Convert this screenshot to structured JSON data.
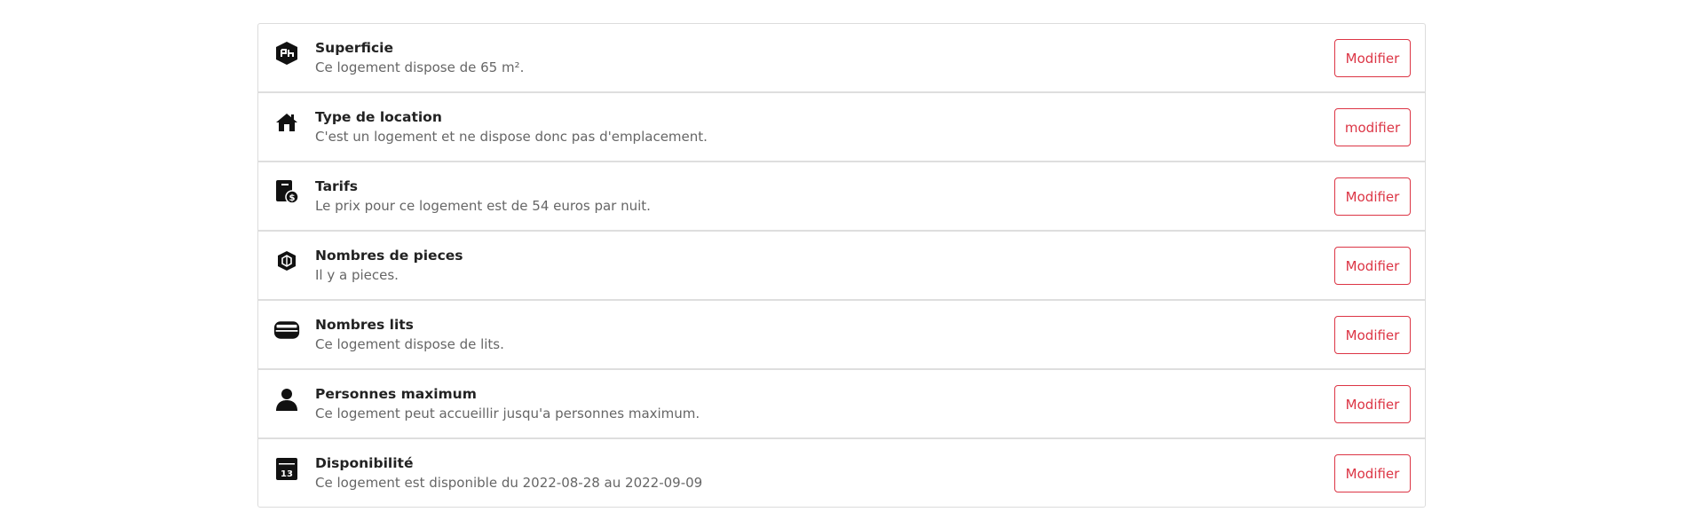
{
  "items": [
    {
      "icon": "floor-plan-icon",
      "title": "Superficie",
      "description": "Ce logement dispose de 65 m².",
      "button": "Modifier"
    },
    {
      "icon": "house-icon",
      "title": "Type de location",
      "description": "C'est un logement et ne dispose donc pas d'emplacement.",
      "button": "modifier"
    },
    {
      "icon": "price-tag-icon",
      "title": "Tarifs",
      "description": "Le prix pour ce logement est de 54 euros par nuit.",
      "button": "Modifier"
    },
    {
      "icon": "rooms-cube-icon",
      "title": "Nombres de pieces",
      "description": "Il y a pieces.",
      "button": "Modifier"
    },
    {
      "icon": "bed-icon",
      "title": "Nombres lits",
      "description": "Ce logement dispose de lits.",
      "button": "Modifier"
    },
    {
      "icon": "person-icon",
      "title": "Personnes maximum",
      "description": "Ce logement peut accueillir jusqu'a personnes maximum.",
      "button": "Modifier"
    },
    {
      "icon": "calendar-icon",
      "icon_text": "13",
      "title": "Disponibilité",
      "description": "Ce logement est disponible du 2022-08-28 au 2022-09-09",
      "button": "Modifier"
    }
  ],
  "colors": {
    "accent": "#dc3545",
    "title": "#222222",
    "description": "#666666",
    "border": "#dedede"
  }
}
